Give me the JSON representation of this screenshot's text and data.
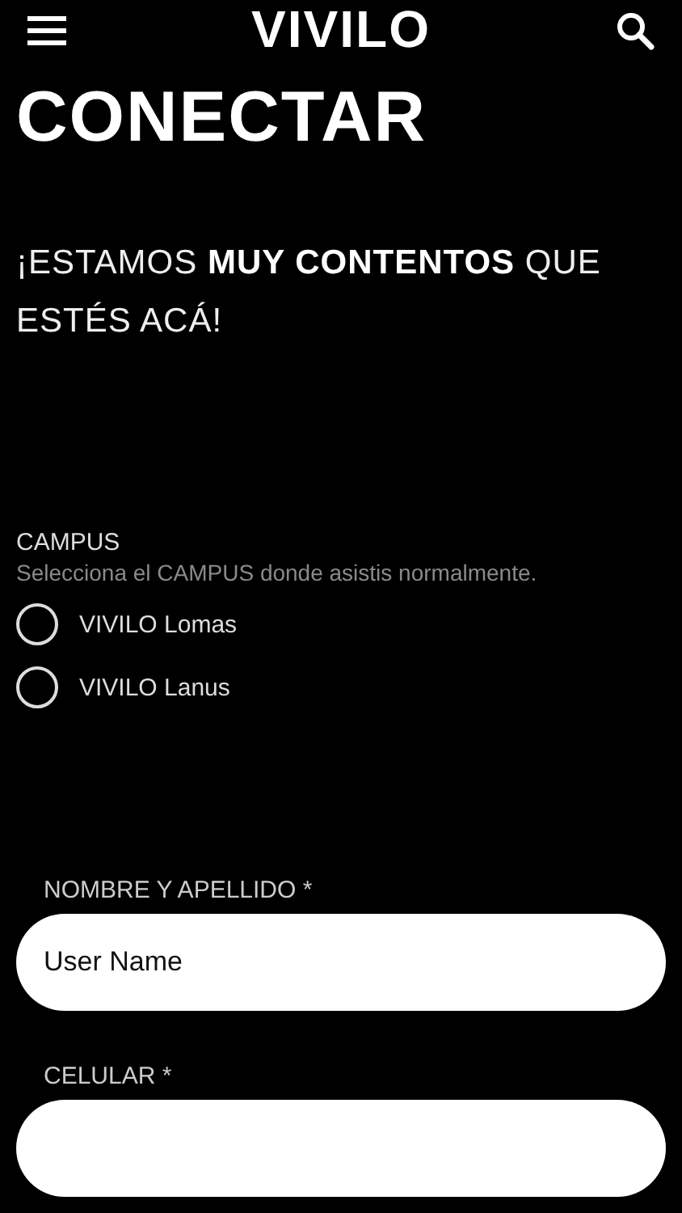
{
  "header": {
    "logo": "VIVILO"
  },
  "title": "CONECTAR",
  "greeting": "¡ESTAMOS **MUY CONTENTOS** QUE ESTÉS ACÁ!",
  "campus": {
    "label": "CAMPUS",
    "hint": "Selecciona el CAMPUS donde asistis normalmente.",
    "options": [
      {
        "label": "VIVILO Lomas",
        "selected": false
      },
      {
        "label": "VIVILO Lanus",
        "selected": false
      }
    ]
  },
  "fields": [
    {
      "label": "NOMBRE Y APELLIDO *",
      "value": "User Name"
    },
    {
      "label": "CELULAR *"
    }
  ]
}
